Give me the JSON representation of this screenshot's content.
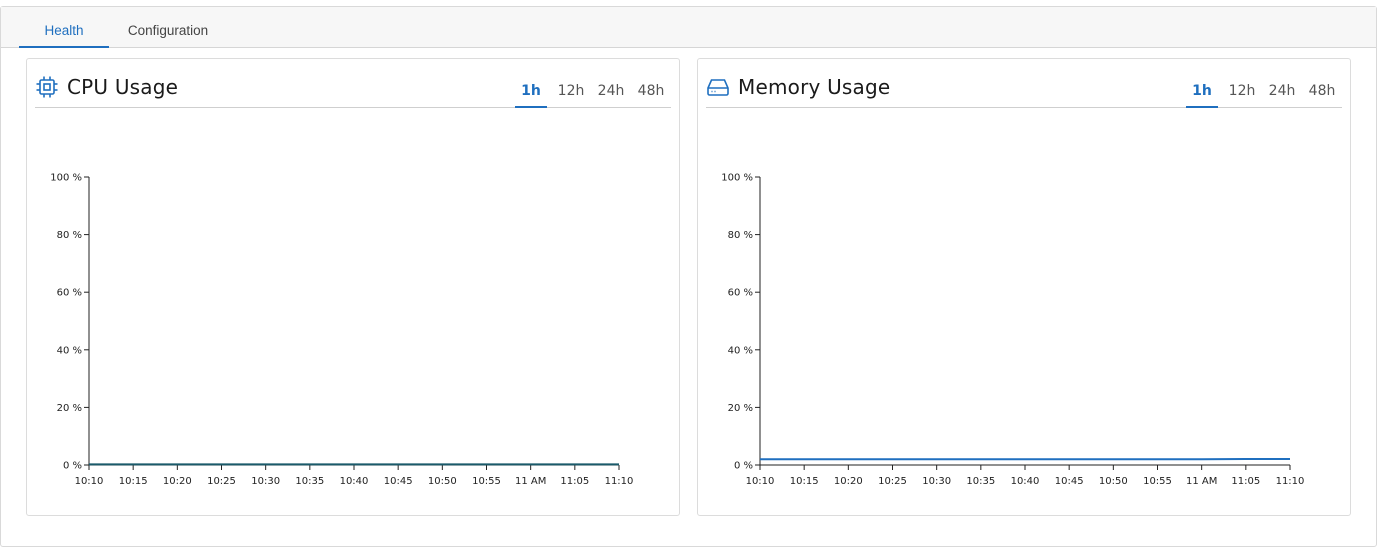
{
  "tabs": [
    {
      "label": "Health",
      "active": true
    },
    {
      "label": "Configuration",
      "active": false
    }
  ],
  "accent_color": "#1f6fbf",
  "cpu_panel": {
    "title": "CPU Usage",
    "icon": "cpu-chip-icon",
    "ranges": [
      "1h",
      "12h",
      "24h",
      "48h"
    ],
    "active_range": "1h"
  },
  "memory_panel": {
    "title": "Memory Usage",
    "icon": "hard-drive-icon",
    "ranges": [
      "1h",
      "12h",
      "24h",
      "48h"
    ],
    "active_range": "1h"
  },
  "chart_data": [
    {
      "type": "line",
      "title": "CPU Usage",
      "x": [
        "10:10",
        "10:15",
        "10:20",
        "10:25",
        "10:30",
        "10:35",
        "10:40",
        "10:45",
        "10:50",
        "10:55",
        "11 AM",
        "11:05",
        "11:10"
      ],
      "series": [
        {
          "values": [
            0.2,
            0.2,
            0.2,
            0.2,
            0.2,
            0.2,
            0.2,
            0.2,
            0.2,
            0.2,
            0.2,
            0.2,
            0.2
          ],
          "color": "#1a5a6a"
        }
      ],
      "y_ticks": [
        "0 %",
        "20 %",
        "40 %",
        "60 %",
        "80 %",
        "100 %"
      ],
      "ylim": [
        0,
        100
      ],
      "grid": false
    },
    {
      "type": "line",
      "title": "Memory Usage",
      "x": [
        "10:10",
        "10:15",
        "10:20",
        "10:25",
        "10:30",
        "10:35",
        "10:40",
        "10:45",
        "10:50",
        "10:55",
        "11 AM",
        "11:05",
        "11:10"
      ],
      "series": [
        {
          "values": [
            2,
            2,
            2,
            2,
            2,
            2,
            2,
            2,
            2,
            2,
            2,
            2.1,
            2.1
          ],
          "color": "#1f6fbf"
        }
      ],
      "y_ticks": [
        "0 %",
        "20 %",
        "40 %",
        "60 %",
        "80 %",
        "100 %"
      ],
      "ylim": [
        0,
        100
      ],
      "grid": false
    }
  ]
}
